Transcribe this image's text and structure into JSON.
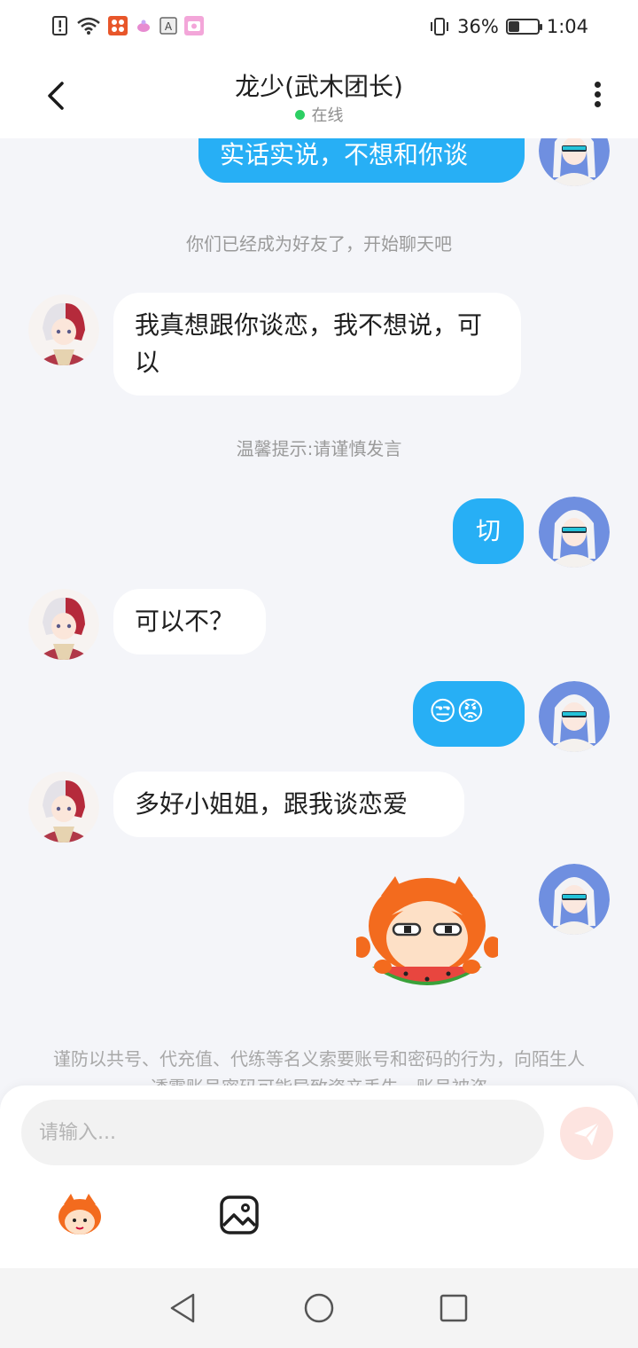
{
  "status_bar": {
    "battery_percent": "36%",
    "battery_level": 0.36,
    "time": "1:04",
    "icons": [
      "alert-icon",
      "wifi-icon",
      "app-notification-icon",
      "app-notification-icon",
      "keyboard-icon",
      "camera-icon",
      "vibrate-icon",
      "battery-icon"
    ]
  },
  "header": {
    "title": "龙少(武木团长)",
    "status": "在线",
    "status_color": "#2ccf63"
  },
  "chat": {
    "top_message": "实话实说，不想和你谈",
    "system_friend": "你们已经成为好友了，开始聊天吧",
    "msg_other_1": "我真想跟你谈恋，我不想说，可以",
    "system_tip": "温馨提示:请谨慎发言",
    "msg_me_1": "切",
    "msg_other_2": "可以不？",
    "msg_me_2_emoji": "😒😡",
    "msg_other_3": "多好小姐姐，跟我谈恋爱",
    "msg_me_3_sticker": "watermelon-sticker",
    "warning": "谨防以共号、代充值、代练等名义索要账号和密码的行为，向陌生人透露账号密码可能导致资产丢失，账号被盗"
  },
  "input": {
    "placeholder": "请输入..."
  },
  "colors": {
    "my_bubble": "#27aff5",
    "other_bubble": "#ffffff",
    "background": "#f4f5f9",
    "send_button": "#fde4e0"
  }
}
